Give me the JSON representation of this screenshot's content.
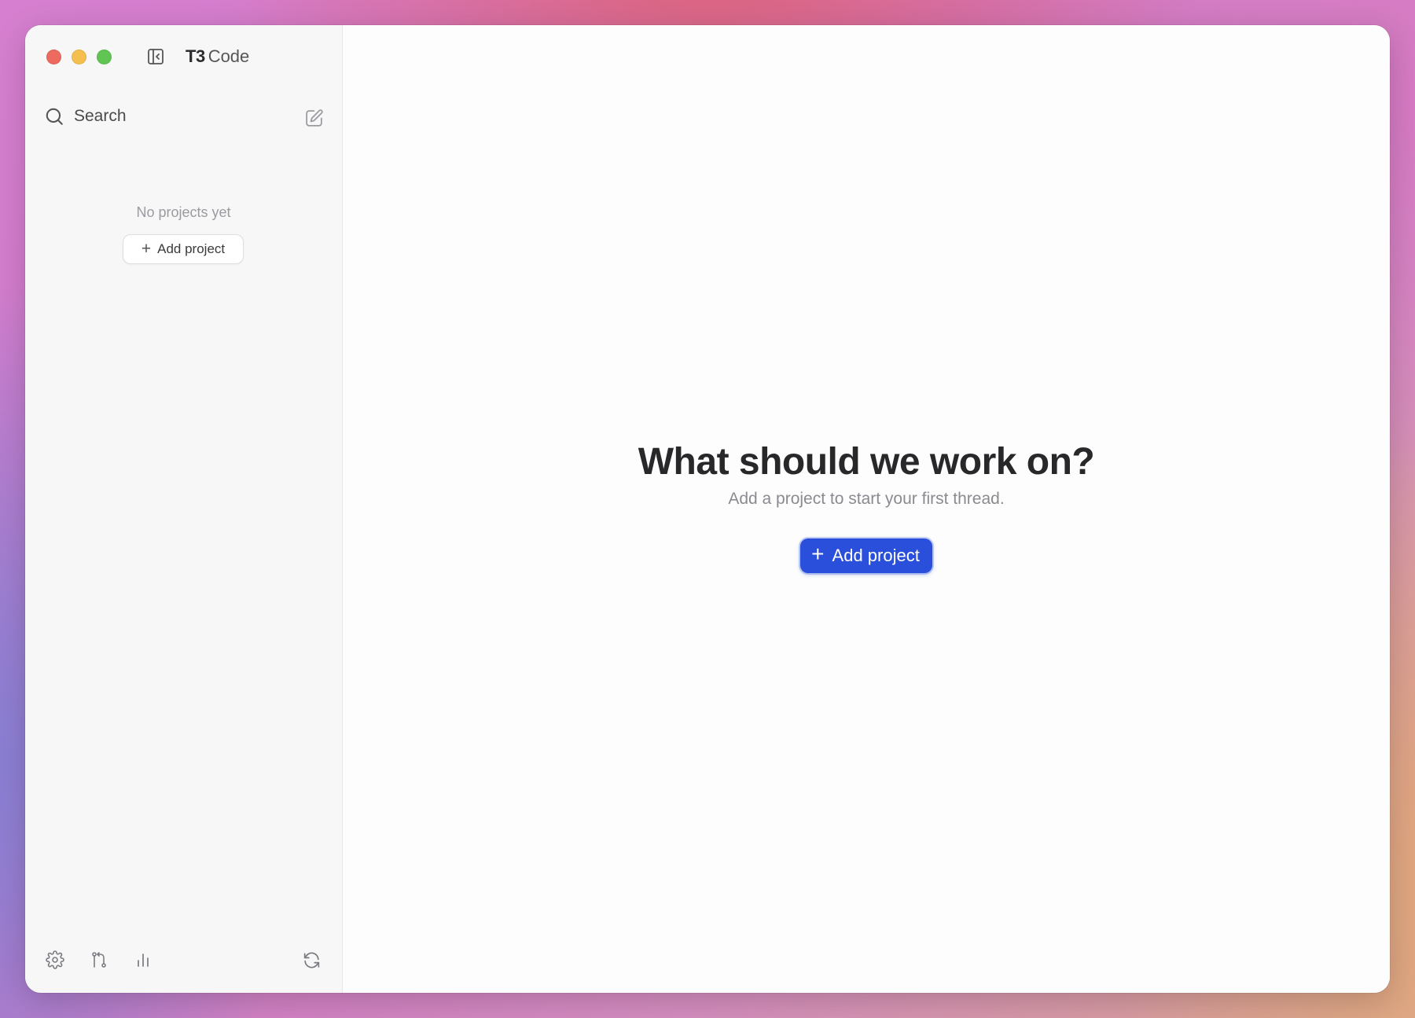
{
  "window": {
    "controls": [
      "close",
      "minimize",
      "maximize"
    ]
  },
  "app": {
    "title_bold": "T3",
    "title_rest": "Code"
  },
  "sidebar": {
    "search_label": "Search",
    "empty_text": "No projects yet",
    "add_project_label": "Add project",
    "footer_icons": [
      "settings-icon",
      "git-branch-icon",
      "bar-chart-icon",
      "refresh-icon"
    ]
  },
  "main": {
    "heading": "What should we work on?",
    "subheading": "Add a project to start your first thread.",
    "add_project_label": "Add project"
  },
  "colors": {
    "accent": "#2a4fdb",
    "close": "#ed6a5e",
    "minimize": "#f4bf4f",
    "maximize": "#61c554"
  }
}
